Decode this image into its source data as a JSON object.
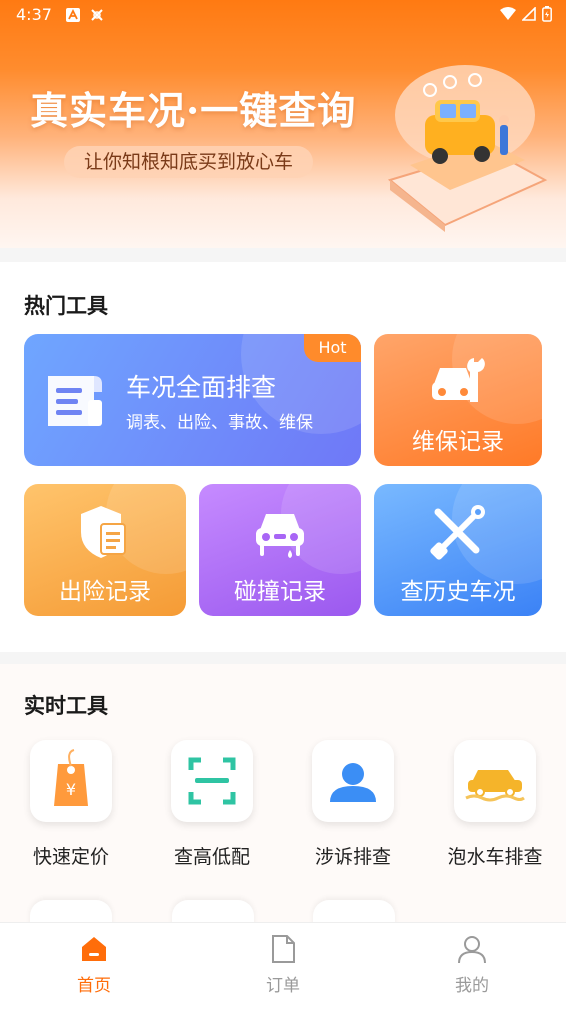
{
  "status_bar": {
    "time": "4:37"
  },
  "banner": {
    "headline": "真实车况·一键查询",
    "subline": "让你知根知底买到放心车"
  },
  "hot_tools": {
    "title": "热门工具",
    "main_card": {
      "title": "车况全面排查",
      "desc": "调表、出险、事故、维保",
      "badge": "Hot"
    },
    "cards": [
      {
        "label": "维保记录",
        "icon": "car-wrench-icon"
      },
      {
        "label": "出险记录",
        "icon": "shield-document-icon"
      },
      {
        "label": "碰撞记录",
        "icon": "car-crash-icon"
      },
      {
        "label": "查历史车况",
        "icon": "tools-icon"
      }
    ]
  },
  "realtime_tools": {
    "title": "实时工具",
    "items": [
      {
        "label": "快速定价",
        "icon": "price-tag-icon"
      },
      {
        "label": "查高低配",
        "icon": "scan-icon"
      },
      {
        "label": "涉诉排查",
        "icon": "person-icon"
      },
      {
        "label": "泡水车排查",
        "icon": "flooded-car-icon"
      }
    ]
  },
  "bottom_nav": [
    {
      "label": "首页",
      "icon": "home-icon",
      "active": true
    },
    {
      "label": "订单",
      "icon": "document-icon",
      "active": false
    },
    {
      "label": "我的",
      "icon": "user-icon",
      "active": false
    }
  ],
  "colors": {
    "accent": "#ff6d0a",
    "blue_card": "#6f8cf9",
    "orange_card": "#ff8a3a",
    "purple_card": "#a866f5"
  }
}
